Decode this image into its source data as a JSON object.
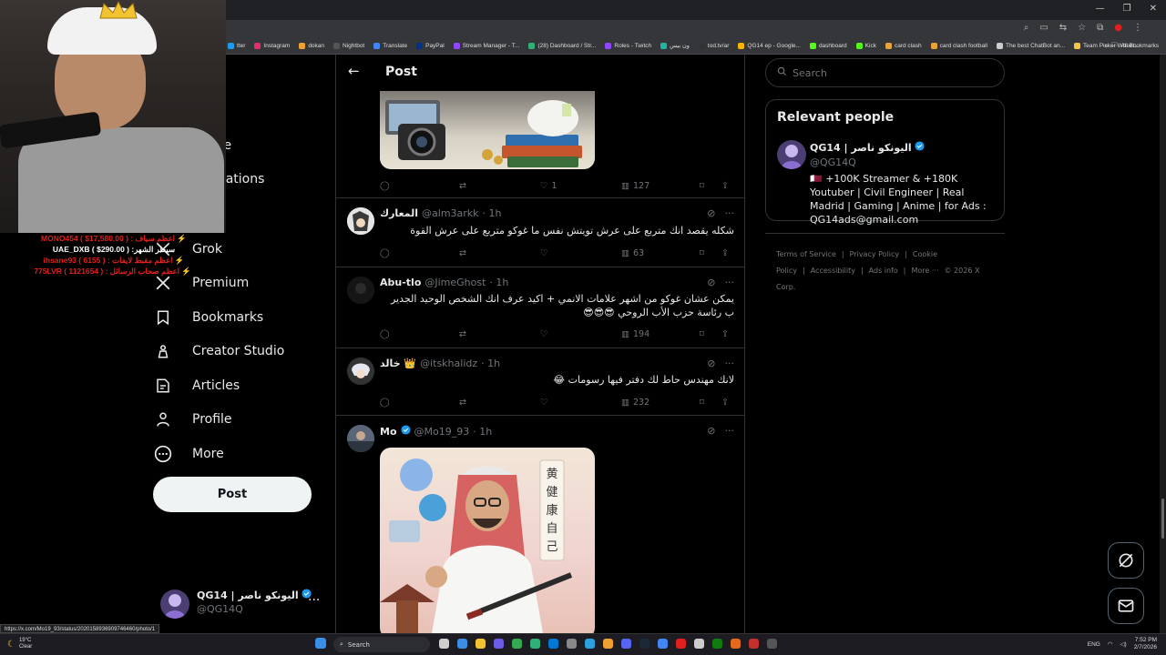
{
  "browser": {
    "bookmarks": [
      {
        "label": "tter",
        "color": "#1d9bf0"
      },
      {
        "label": "Instagram",
        "color": "#e1306c"
      },
      {
        "label": "dokan",
        "color": "#f0a030"
      },
      {
        "label": "Nightbot",
        "color": "#555555"
      },
      {
        "label": "Translate",
        "color": "#4285f4"
      },
      {
        "label": "PayPal",
        "color": "#003087"
      },
      {
        "label": "Stream Manager - T...",
        "color": "#9146ff"
      },
      {
        "label": "(28) Dashboard / Str...",
        "color": "#2fb079"
      },
      {
        "label": "Roles - Twitch",
        "color": "#9146ff"
      },
      {
        "label": "ون بيس",
        "color": "#20b5a0"
      },
      {
        "label": "tod.tv/ar",
        "color": "#333333"
      },
      {
        "label": "QG14 ep - Google...",
        "color": "#f4b400"
      },
      {
        "label": "dashboard",
        "color": "#53fc18"
      },
      {
        "label": "Kick",
        "color": "#53fc18"
      },
      {
        "label": "card clash",
        "color": "#e8a43a"
      },
      {
        "label": "card clash football",
        "color": "#e8a43a"
      },
      {
        "label": "The best ChatBot an...",
        "color": "#cccccc"
      },
      {
        "label": "Team Picker Wheel...",
        "color": "#f6c342"
      }
    ],
    "all_bookmarks": "All Bookmarks",
    "status_url": "https://x.com/Mo19_93/status/2020158936909746460/photo/1"
  },
  "stream": {
    "donations": [
      {
        "text": "⚡ اعظم سياف : MONO454 ( $17,580.00 )",
        "color": "#e0201c"
      },
      {
        "text": "سيطر الشهر: UAE_DXB ( $290.00 )",
        "color": "#ffffff"
      },
      {
        "text": "⚡ اعظم مقبط لايفات : ihsane93 ( 6155 )",
        "color": "#e0201c"
      },
      {
        "text": "⚡ اعظم صحاب الرسائل : 775LVR ( 1121654 )",
        "color": "#e0201c"
      }
    ]
  },
  "nav": {
    "ghost_labels": [
      "e",
      "re",
      "cations"
    ],
    "items": [
      {
        "label": "Grok",
        "icon": "grok-icon"
      },
      {
        "label": "Premium",
        "icon": "x-logo-icon"
      },
      {
        "label": "Bookmarks",
        "icon": "bookmark-icon"
      },
      {
        "label": "Creator Studio",
        "icon": "creator-studio-icon"
      },
      {
        "label": "Articles",
        "icon": "articles-icon"
      },
      {
        "label": "Profile",
        "icon": "profile-icon"
      },
      {
        "label": "More",
        "icon": "more-circle-icon"
      }
    ],
    "post_button": "Post"
  },
  "account": {
    "name": "QG14 | اليونكو ناصر",
    "handle": "@QG14Q"
  },
  "header": {
    "title": "Post"
  },
  "tweets": [
    {
      "id": "top",
      "replies": "",
      "retweets": "",
      "likes": "1",
      "views": "127"
    },
    {
      "id": "almarek",
      "name": "المعارك",
      "handle": "@alm3arkk",
      "time": "· 1h",
      "text": "شكله يقصد انك متربع على عرش تويتش نفس ما غوكو متربع على عرش القوة",
      "likes": "",
      "views": "63"
    },
    {
      "id": "abutlo",
      "name": "Abu-tlo",
      "handle": "@JimeGhost",
      "time": "· 1h",
      "text": "يمكن عشان غوكو من اشهر علامات الانمي + اكيد عرف انك الشخص الوحيد الجدير ب رئاسة حزب الأب الروحي 😎😎😎",
      "likes": "",
      "views": "194"
    },
    {
      "id": "khaled",
      "name": "خالد 👑",
      "handle": "@itskhalidz",
      "time": "· 1h",
      "text": "لانك مهندس حاط لك دفتر فيها رسومات 😂",
      "likes": "",
      "views": "232"
    },
    {
      "id": "mo",
      "name": "Mo",
      "handle": "@Mo19_93",
      "time": "· 1h",
      "image_text": "黄 健 康 自 己"
    }
  ],
  "right": {
    "search_placeholder": "Search",
    "relevant_title": "Relevant people",
    "person": {
      "name": "QG14 | اليونكو ناصر",
      "handle": "@QG14Q",
      "bio": "🇶🇦 +100K Streamer & +180K Youtuber | Civil Engineer | Real Madrid | Gaming | Anime | for Ads : QG14ads@gmail.com"
    },
    "footer": [
      "Terms of Service",
      "|",
      "Privacy Policy",
      "|",
      "Cookie Policy",
      "|",
      "Accessibility",
      "|",
      "Ads info",
      "|",
      "More ···",
      "© 2026 X Corp."
    ]
  },
  "taskbar": {
    "temp": "19°C",
    "condition": "Clear",
    "search": "Search",
    "lang": "ENG",
    "time": "7:52 PM",
    "date": "2/7/2026"
  },
  "colors": {
    "verified": "#1d9bf0",
    "border": "#2f3336",
    "muted": "#71767b"
  }
}
